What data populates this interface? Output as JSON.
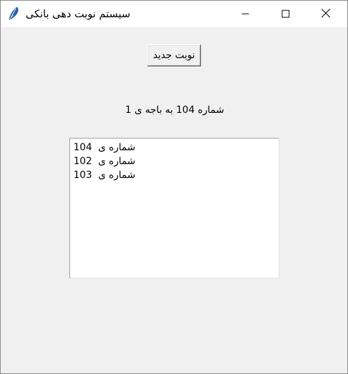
{
  "window": {
    "title": "سیستم نوبت دهی بانکی",
    "app_icon": "feather-icon",
    "controls": [
      "minimize-icon",
      "maximize-icon",
      "close-icon"
    ]
  },
  "main": {
    "new_ticket_button_label": "نوبت جدید",
    "status_label": "شماره 104 به باجه ی 1",
    "queue_items": [
      {
        "number": "104",
        "label": "شماره ی"
      },
      {
        "number": "102",
        "label": "شماره ی"
      },
      {
        "number": "103",
        "label": "شماره ی"
      }
    ]
  }
}
